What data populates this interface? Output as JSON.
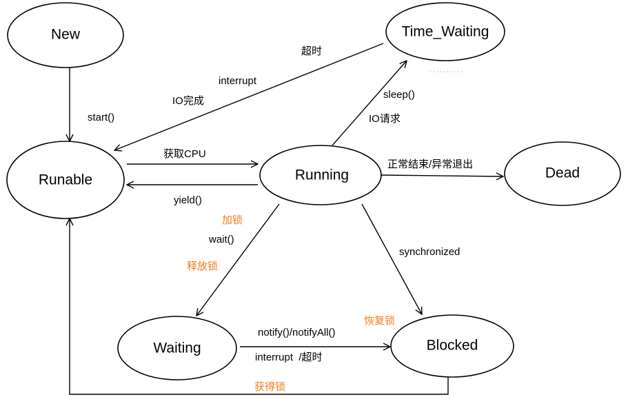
{
  "colors": {
    "line": "#000000",
    "accent": "#f07d1c",
    "background": "#ffffff"
  },
  "states": {
    "new": "New",
    "runable": "Runable",
    "running": "Running",
    "time_waiting": "Time_Waiting",
    "dead": "Dead",
    "waiting": "Waiting",
    "blocked": "Blocked"
  },
  "edges": {
    "new_to_runable": {
      "label": "start()"
    },
    "time_waiting_to_runable": {
      "labels": [
        "超时",
        "interrupt",
        "IO完成"
      ]
    },
    "runable_to_running": {
      "label": "获取CPU"
    },
    "running_to_runable": {
      "label": "yield()"
    },
    "running_to_time_waiting": {
      "labels": [
        "sleep()",
        "IO请求"
      ]
    },
    "running_to_dead": {
      "label": "正常结束/异常退出"
    },
    "running_to_waiting": {
      "labels": [
        "加锁",
        "wait()",
        "释放锁"
      ]
    },
    "running_to_blocked": {
      "label": "synchronized"
    },
    "waiting_to_blocked": {
      "labels": [
        "notify()/notifyAll()",
        "interrupt  /超时"
      ]
    },
    "blocked_resume": {
      "label": "恢复锁"
    },
    "blocked_to_runable": {
      "label": "获得锁"
    }
  }
}
